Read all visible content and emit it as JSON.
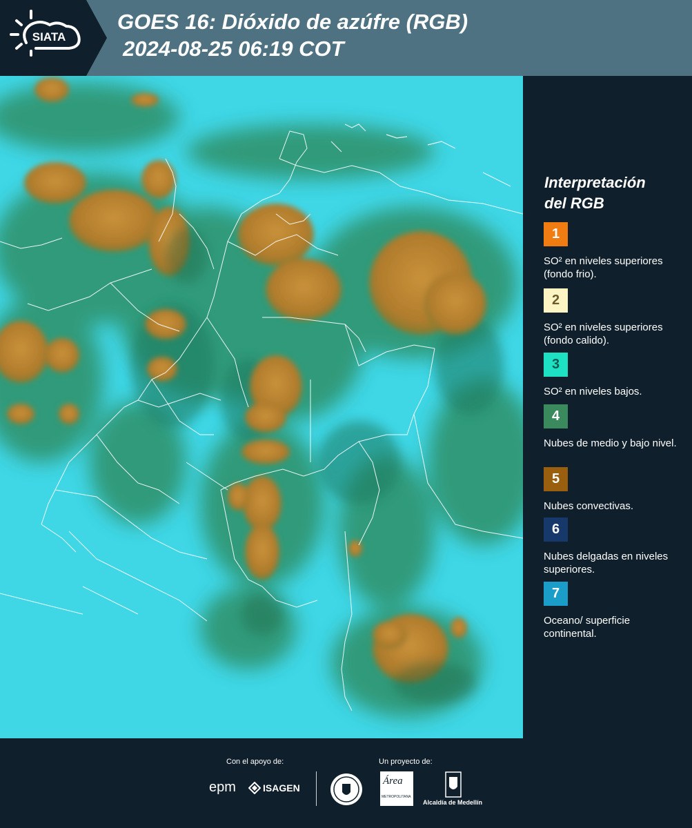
{
  "header": {
    "logo_text": "SIATA",
    "title_line1": "GOES 16: Dióxido de azúfre (RGB)",
    "title_line2": "2024-08-25 06:19 COT"
  },
  "legend": {
    "title_line1": "Interpretación",
    "title_line2": "del RGB",
    "items": [
      {
        "number": "1",
        "color": "#f07c12",
        "number_color": "#ffffff",
        "label": "SO² en niveles superiores (fondo frio)."
      },
      {
        "number": "2",
        "color": "#fdf4c4",
        "number_color": "#6b5a2a",
        "label": "SO² en niveles superiores (fondo calido)."
      },
      {
        "number": "3",
        "color": "#1de1c2",
        "number_color": "#0f5c55",
        "label": "SO² en niveles bajos."
      },
      {
        "number": "4",
        "color": "#3a8a5e",
        "number_color": "#ffffff",
        "label": "Nubes de medio y bajo nivel."
      },
      {
        "number": "5",
        "color": "#9a5e0f",
        "number_color": "#ffffff",
        "label": "Nubes convectivas."
      },
      {
        "number": "6",
        "color": "#17386a",
        "number_color": "#ffffff",
        "label": "Nubes delgadas en niveles superiores."
      },
      {
        "number": "7",
        "color": "#1a9ec9",
        "number_color": "#ffffff",
        "label": "Oceano/ superficie continental."
      }
    ]
  },
  "footer": {
    "support_caption": "Con el apoyo de:",
    "project_caption": "Un proyecto de:",
    "sponsors": {
      "epm": "epm",
      "isagen": "ISAGEN",
      "area_metro": "Área",
      "area_metro_sub": "METROPOLITANA",
      "alcaldia": "Alcaldía de Medellín"
    }
  },
  "colors": {
    "header_bg": "#4e7282",
    "panel_bg": "#0f1f2b",
    "ocean_cyan": "#3fd6e6",
    "convective_brown": "#b8822a",
    "vegetation_green": "#2d8f5e",
    "border_white": "#ffffff"
  }
}
